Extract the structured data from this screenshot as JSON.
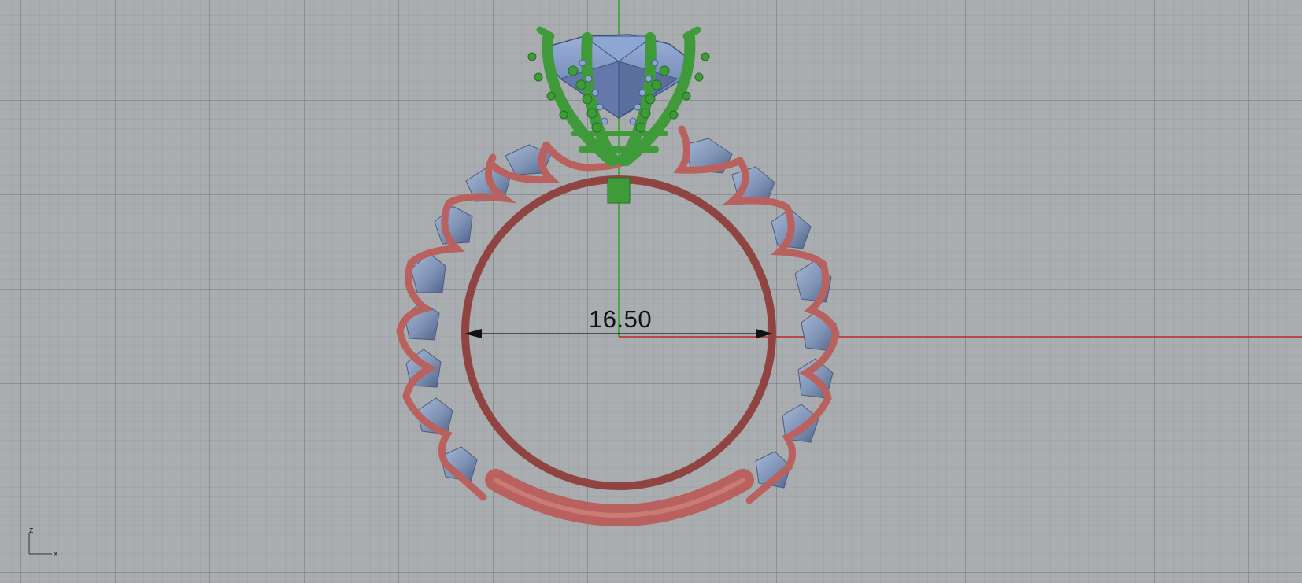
{
  "viewport": {
    "projection": "front",
    "background_color": "#a9adb0",
    "grid": true
  },
  "dimension": {
    "label": "16.50",
    "type": "linear-horizontal"
  },
  "axes": {
    "x_label": "x",
    "z_label": "z",
    "x_axis_color": "#c0282a",
    "z_axis_color": "#22aa22"
  },
  "model": {
    "band_color": "#b8615e",
    "gem_color": "#7f93b6",
    "setting_color": "#3f9b3a",
    "center_stone_color": "#6f88bb",
    "icons": [
      "ring-model-icon",
      "axis-indicator-icon"
    ]
  }
}
